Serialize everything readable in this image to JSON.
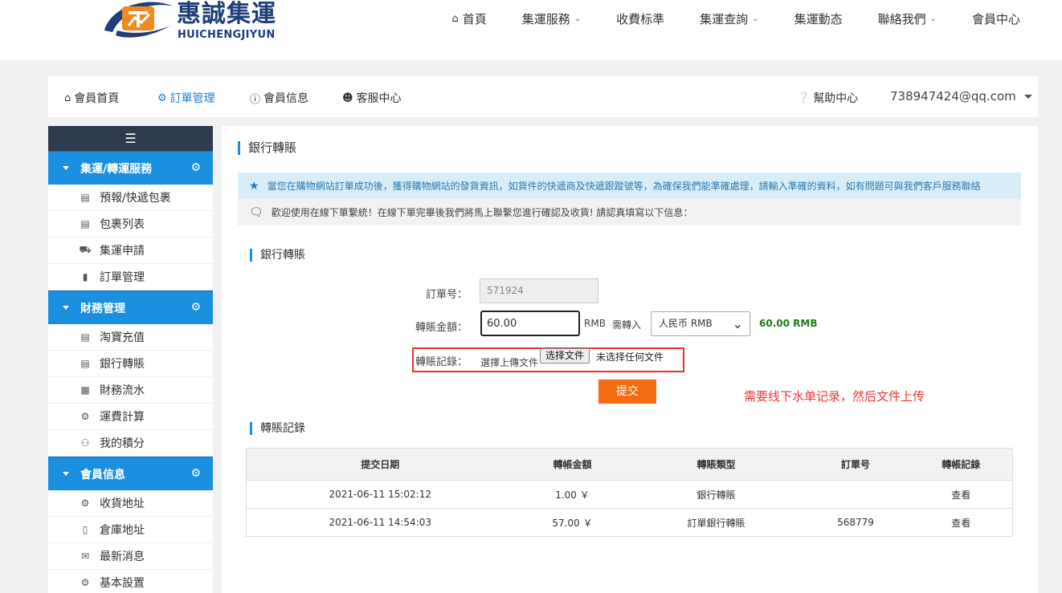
{
  "brand": {
    "name_cn": "惠誠集運",
    "name_en": "HUICHENGJIYUN",
    "colors": {
      "primary": "#1f3e7a",
      "accent": "#f08a1e"
    }
  },
  "topnav": {
    "items": [
      {
        "icon": "home-icon",
        "label": "首頁",
        "has_dropdown": false
      },
      {
        "label": "集運服務",
        "has_dropdown": true
      },
      {
        "label": "收費标準",
        "has_dropdown": false
      },
      {
        "label": "集運查詢",
        "has_dropdown": true
      },
      {
        "label": "集運動态",
        "has_dropdown": false
      },
      {
        "label": "聯絡我們",
        "has_dropdown": true
      },
      {
        "label": "會員中心",
        "has_dropdown": false
      }
    ]
  },
  "memberbar": {
    "home": "會員首頁",
    "orders": "訂單管理",
    "info": "會員信息",
    "service": "客服中心",
    "help": "幫助中心",
    "email": "738947424@qq.com"
  },
  "sidebar": {
    "toggle_icon": "menu-icon",
    "sections": [
      {
        "title": "集運/轉運服務",
        "items": [
          {
            "icon": "inbox-icon",
            "label": "預報/快遞包裹"
          },
          {
            "icon": "list-icon",
            "label": "包裹列表"
          },
          {
            "icon": "truck-icon",
            "label": "集運申請"
          },
          {
            "icon": "book-icon",
            "label": "訂單管理"
          }
        ]
      },
      {
        "title": "財務管理",
        "items": [
          {
            "icon": "card-icon",
            "label": "淘寶充值"
          },
          {
            "icon": "card-icon",
            "label": "銀行轉賬"
          },
          {
            "icon": "bar-chart-icon",
            "label": "財務流水"
          },
          {
            "icon": "cogs-icon",
            "label": "運費計算"
          },
          {
            "icon": "gift-icon",
            "label": "我的積分"
          }
        ]
      },
      {
        "title": "會員信息",
        "items": [
          {
            "icon": "cogs-icon",
            "label": "收貨地址"
          },
          {
            "icon": "building-icon",
            "label": "倉庫地址"
          },
          {
            "icon": "envelope-icon",
            "label": "最新消息"
          },
          {
            "icon": "gear-icon",
            "label": "基本設置"
          }
        ]
      }
    ]
  },
  "main": {
    "title": "銀行轉賬",
    "notice_info": "當您在購物網站訂單成功後，獲得購物網站的發貨資訊，如貨件的快遞商及快遞跟蹤號等，為確保我們能準確處理，請輸入準確的資料，如有問題可與我們客戶服務聯絡",
    "notice_welcome": "歡迎使用在線下單繫統！在線下單完畢後我們將馬上聯繫您進行確認及收貨! 請認真填寫以下信息：",
    "form_title": "銀行轉賬",
    "form": {
      "order_label": "訂單号：",
      "order_value": "571924",
      "amount_label": "轉賬金額：",
      "amount_value": "60.00",
      "amount_unit": "RMB",
      "need_transfer": "需轉入",
      "currency": "人民币 RMB",
      "converted": "60.00 RMB",
      "record_label": "轉賬記錄：",
      "upload_text": "選擇上傳文件",
      "file_button": "选择文件",
      "file_none": "未选择任何文件",
      "submit": "提交"
    },
    "annotation": "需要线下水单记录，然后文件上传",
    "records_title": "轉賬記錄",
    "table": {
      "headers": [
        "提交日期",
        "轉帳金額",
        "轉賬類型",
        "訂單号",
        "轉帳記錄"
      ],
      "rows": [
        {
          "date": "2021-06-11 15:02:12",
          "amount": "1.00 ￥",
          "type": "銀行轉賬",
          "order": "",
          "record": "查看"
        },
        {
          "date": "2021-06-11 14:54:03",
          "amount": "57.00 ￥",
          "type": "訂單銀行轉賬",
          "order": "568779",
          "record": "查看"
        }
      ]
    }
  }
}
